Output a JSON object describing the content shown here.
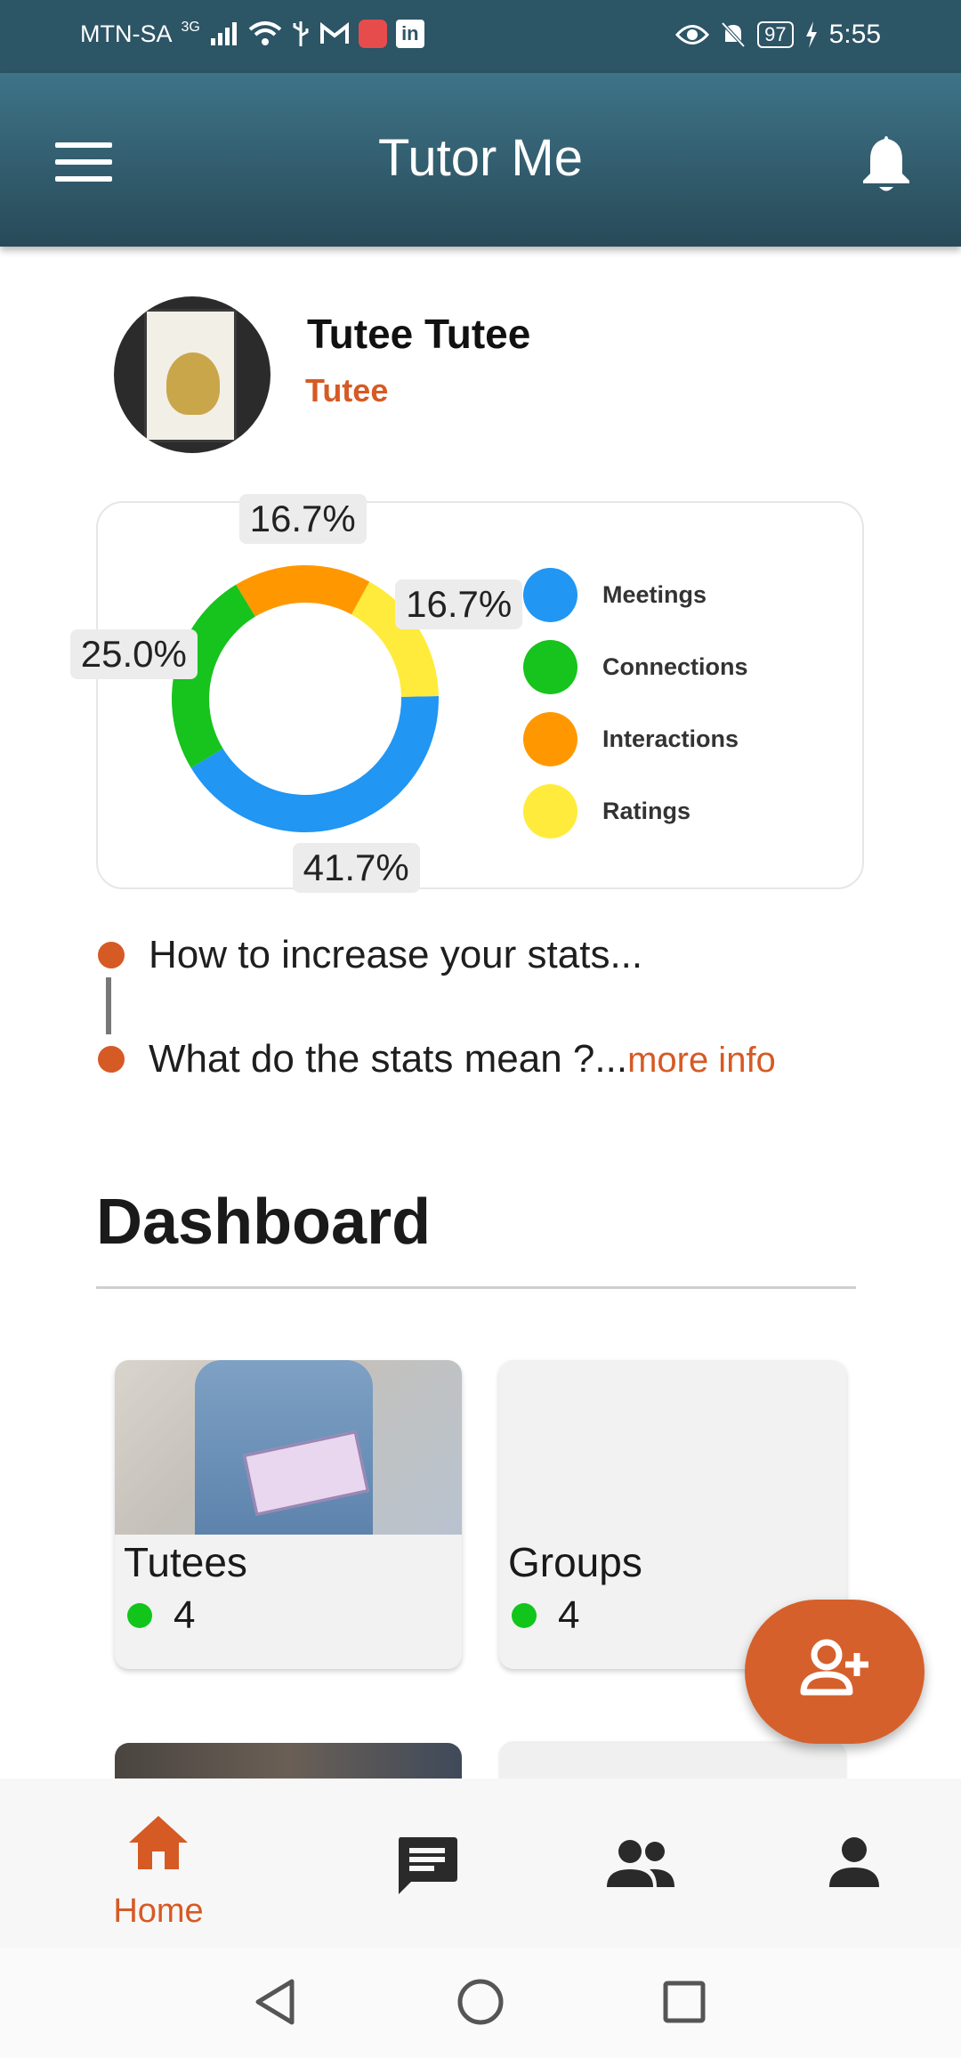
{
  "status_bar": {
    "carrier": "MTN-SA",
    "network": "3G",
    "battery": "97",
    "time": "5:55"
  },
  "app_bar": {
    "title": "Tutor Me",
    "menu_icon": "hamburger-menu-icon",
    "notification_icon": "bell-icon"
  },
  "profile": {
    "name": "Tutee Tutee",
    "role": "Tutee"
  },
  "stats": {
    "chart_data": {
      "type": "pie",
      "style": "donut",
      "title": "",
      "categories": [
        "Meetings",
        "Connections",
        "Interactions",
        "Ratings"
      ],
      "values": [
        41.7,
        25.0,
        16.7,
        16.7
      ],
      "labels": [
        "41.7%",
        "25.0%",
        "16.7%",
        "16.7%"
      ],
      "colors": [
        "#2196f3",
        "#17c31d",
        "#ff9800",
        "#ffeb3b"
      ],
      "legend_position": "right"
    }
  },
  "info_items": [
    {
      "text": "How to increase your stats..."
    },
    {
      "text": "What do the stats mean ?...",
      "link": "more info"
    }
  ],
  "dashboard": {
    "title": "Dashboard",
    "tiles": [
      {
        "label": "Tutees",
        "count": "4"
      },
      {
        "label": "Groups",
        "count": "4"
      }
    ]
  },
  "fab": {
    "icon": "add-person-icon"
  },
  "bottom_nav": [
    {
      "label": "Home",
      "icon": "home-icon",
      "active": true
    },
    {
      "label": "",
      "icon": "chat-icon",
      "active": false
    },
    {
      "label": "",
      "icon": "people-icon",
      "active": false
    },
    {
      "label": "",
      "icon": "person-icon",
      "active": false
    }
  ],
  "colors": {
    "app_bar": "#2f5c6d",
    "accent": "#d65a24",
    "online": "#11c51b"
  }
}
